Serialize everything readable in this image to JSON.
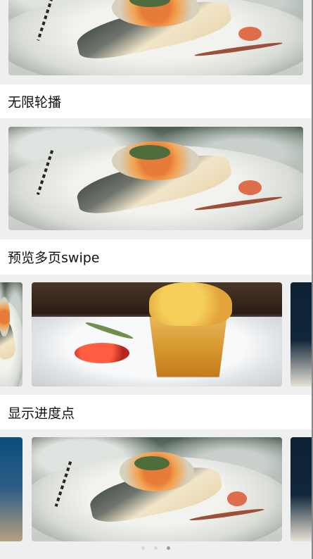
{
  "sections": [
    {
      "label": "无限轮播"
    },
    {
      "label": "预览多页swipe"
    },
    {
      "label": "显示进度点"
    }
  ],
  "carousels": [
    {
      "name": "infinite-carousel",
      "active_slide": "fish-plate"
    },
    {
      "name": "infinite-carousel",
      "active_slide": "fish-plate"
    },
    {
      "name": "preview-carousel",
      "active_slide": "pastry-plate"
    },
    {
      "name": "progress-dots-carousel",
      "active_slide": "fish-plate"
    }
  ],
  "progress": {
    "total": 3,
    "active_index": 2
  }
}
